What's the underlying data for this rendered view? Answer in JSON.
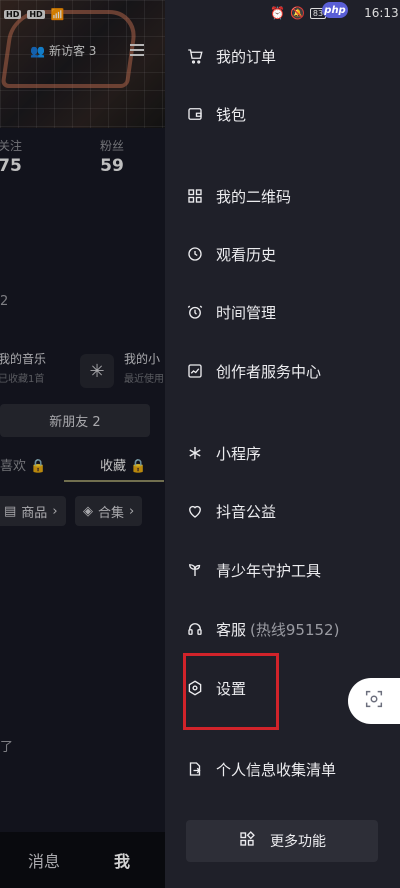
{
  "status_bar": {
    "time": "16:13",
    "battery": "83",
    "net_label_1": "HD",
    "net_label_2": "HD"
  },
  "overlay_badge": "php",
  "profile": {
    "visitors_label": "新访客 3",
    "following_label": "关注",
    "following_count": "75",
    "followers_label": "粉丝",
    "followers_count": "59",
    "stray_text_1": "2",
    "my_music_label": "我的音乐",
    "my_music_sub": "已收藏1首",
    "my_mini_label": "我的小",
    "my_mini_sub": "最近使用",
    "new_friends_button": "新朋友 2",
    "tab_likes": "喜欢",
    "tab_favorites": "收藏",
    "chip_goods": "商品",
    "chip_collections": "合集",
    "stray_text_2": "了",
    "bottom_nav": {
      "messages": "消息",
      "me": "我"
    }
  },
  "drawer": {
    "items": [
      {
        "label": "我的订单",
        "icon": "cart-icon"
      },
      {
        "label": "钱包",
        "icon": "wallet-icon"
      },
      {
        "label": "我的二维码",
        "icon": "qrcode-icon"
      },
      {
        "label": "观看历史",
        "icon": "clock-icon"
      },
      {
        "label": "时间管理",
        "icon": "alarm-icon"
      },
      {
        "label": "创作者服务中心",
        "icon": "chart-icon"
      },
      {
        "label": "小程序",
        "icon": "asterisk-icon"
      },
      {
        "label": "抖音公益",
        "icon": "heart-icon"
      },
      {
        "label": "青少年守护工具",
        "icon": "sprout-icon"
      },
      {
        "label": "客服",
        "hotline": "(热线95152)",
        "icon": "headset-icon"
      },
      {
        "label": "设置",
        "icon": "settings-hexagon-icon"
      },
      {
        "label": "个人信息收集清单",
        "icon": "doc-export-icon"
      }
    ],
    "more_button": "更多功能"
  },
  "colors": {
    "background": "#161823",
    "drawer": "#1f2029",
    "highlight": "#d1232a"
  }
}
